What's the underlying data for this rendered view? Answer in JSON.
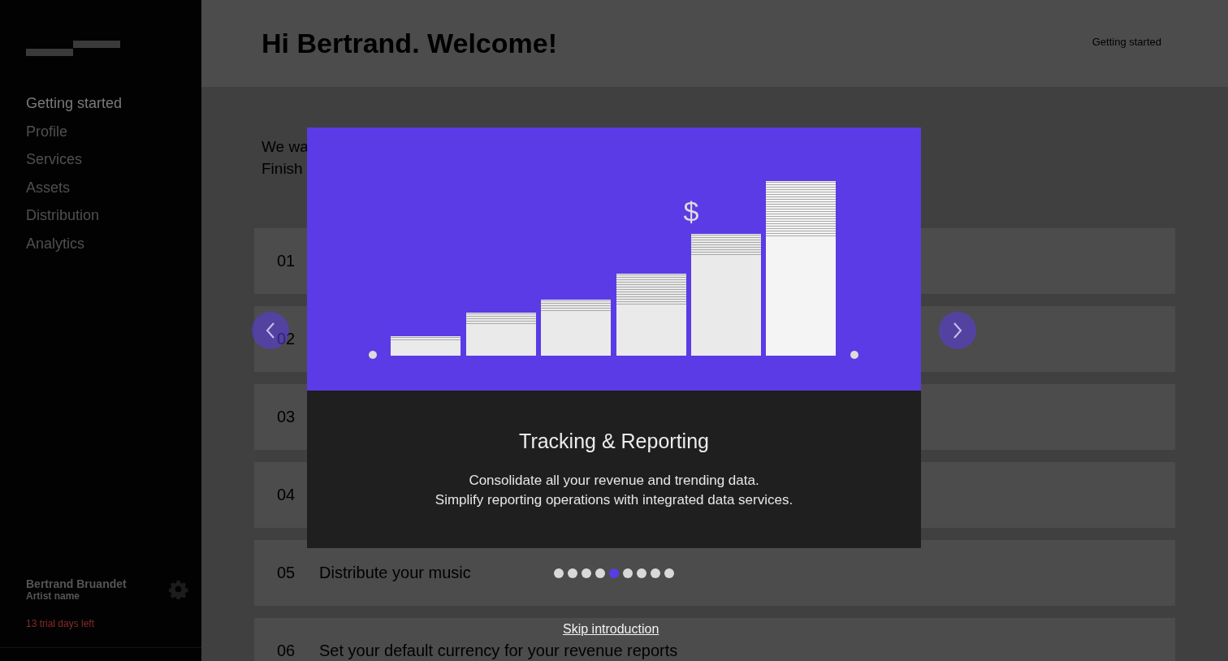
{
  "sidebar": {
    "items": [
      {
        "label": "Getting started",
        "selected": true
      },
      {
        "label": "Profile",
        "selected": false
      },
      {
        "label": "Services",
        "selected": false
      },
      {
        "label": "Assets",
        "selected": false
      },
      {
        "label": "Distribution",
        "selected": false
      },
      {
        "label": "Analytics",
        "selected": false
      }
    ],
    "user": {
      "name": "Bertrand Bruandet",
      "role": "Artist name"
    },
    "trial": "13 trial days left"
  },
  "header": {
    "title": "Hi Bertrand. Welcome!",
    "breadcrumb": "Getting started"
  },
  "intro": [
    "We wa",
    "Finish"
  ],
  "steps": [
    {
      "number": "01"
    },
    {
      "number": "02"
    },
    {
      "number": "03"
    },
    {
      "number": "04"
    },
    {
      "number": "05",
      "label": "Distribute your music"
    },
    {
      "number": "06",
      "label": "Set your default currency for your revenue reports"
    }
  ],
  "modal": {
    "symbol": "$",
    "title": "Tracking & Reporting",
    "text": [
      "Consolidate all your revenue and trending data.",
      "Simplify reporting operations with integrated data services."
    ]
  },
  "dots": [
    {
      "selected": false
    },
    {
      "selected": false
    },
    {
      "selected": false
    },
    {
      "selected": false
    },
    {
      "selected": true
    },
    {
      "selected": false
    },
    {
      "selected": false
    },
    {
      "selected": false
    },
    {
      "selected": false
    }
  ],
  "skip": "Skip introduction"
}
